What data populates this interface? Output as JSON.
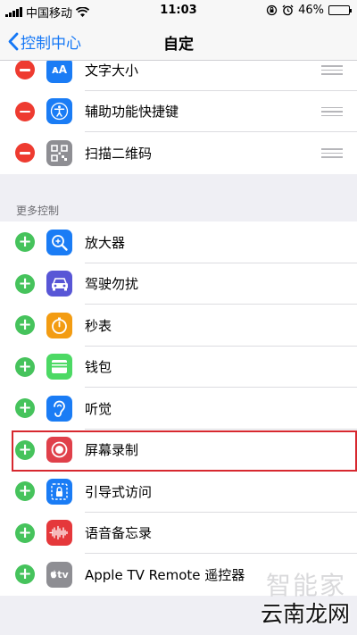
{
  "status": {
    "carrier": "中国移动",
    "time": "11:03",
    "battery": "46%",
    "battery_level": 0.46
  },
  "nav": {
    "back_label": "控制中心",
    "title": "自定"
  },
  "included": [
    {
      "label": "文字大小",
      "icon": "text-size-icon",
      "color": "#1a7cf5"
    },
    {
      "label": "辅助功能快捷键",
      "icon": "accessibility-icon",
      "color": "#1a7cf5"
    },
    {
      "label": "扫描二维码",
      "icon": "qr-code-icon",
      "color": "#8e8e93"
    }
  ],
  "more_header": "更多控制",
  "more": [
    {
      "label": "放大器",
      "icon": "magnifier-icon",
      "color": "#1a7cf5"
    },
    {
      "label": "驾驶勿扰",
      "icon": "car-icon",
      "color": "#5856d6"
    },
    {
      "label": "秒表",
      "icon": "stopwatch-icon",
      "color": "#f39c12"
    },
    {
      "label": "钱包",
      "icon": "wallet-icon",
      "color": "#4cd964"
    },
    {
      "label": "听觉",
      "icon": "ear-icon",
      "color": "#1a7cf5"
    },
    {
      "label": "屏幕录制",
      "icon": "screen-record-icon",
      "color": "#e0404a"
    },
    {
      "label": "引导式访问",
      "icon": "guided-access-icon",
      "color": "#1a7cf5"
    },
    {
      "label": "语音备忘录",
      "icon": "voice-memo-icon",
      "color": "#e5383b"
    },
    {
      "label": "Apple TV Remote 遥控器",
      "icon": "apple-tv-icon",
      "color": "#8e8e93"
    }
  ],
  "watermark": {
    "line1": "智能家",
    "line2": "云南龙网"
  }
}
